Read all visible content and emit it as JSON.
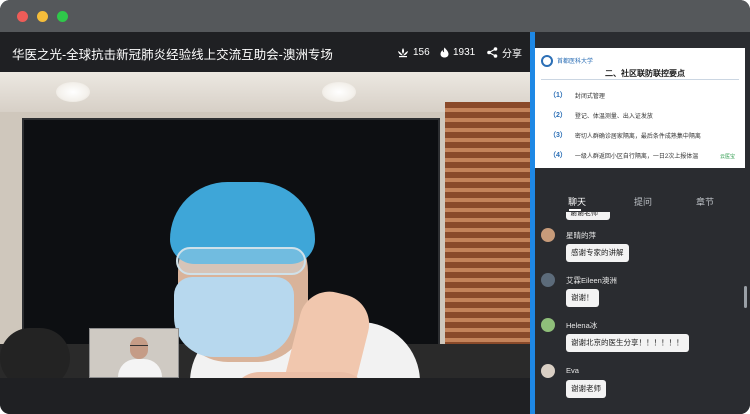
{
  "window": {
    "title_bar_colors": {
      "close": "#ee5c58",
      "minimize": "#f5bd3a",
      "zoom": "#2fc84a"
    }
  },
  "header": {
    "title": "华医之光-全球抗击新冠肺炎经验线上交流互助会-澳洲专场",
    "likes": "156",
    "views": "1931",
    "share_label": "分享"
  },
  "slide": {
    "logo_text": "首都医科大学",
    "title": "二、社区联防联控要点",
    "rows": [
      {
        "num": "（1）",
        "text": "封闭式管理"
      },
      {
        "num": "（2）",
        "text": "登记、体温测量、出入证发放"
      },
      {
        "num": "（3）",
        "text": "密切人群确诊居家隔离，最后条件成熟集中隔离"
      },
      {
        "num": "（4）",
        "text": "一级人群返回小区自行隔离，一日2次上报体温"
      }
    ],
    "brand": "云医宝"
  },
  "tabs": {
    "chat": "聊天",
    "ask": "提问",
    "chapter": "章节"
  },
  "chat": {
    "partial": "谢谢老师",
    "messages": [
      {
        "name": "星晴的萍",
        "text": "感谢专家的讲解",
        "avatar_color": "#c79b7a"
      },
      {
        "name": "艾霖Eileen澳洲",
        "text": "谢谢！",
        "avatar_color": "#5c6b7a"
      },
      {
        "name": "Helena冰",
        "text": "谢谢北京的医生分享！！！！！！",
        "avatar_color": "#8fbf7a"
      },
      {
        "name": "Eva",
        "text": "谢谢老师",
        "avatar_color": "#d9cfc4"
      }
    ]
  },
  "colors": {
    "accent": "#1e88e5",
    "dark_bg": "#1f2023",
    "panel_bg": "#2a2c30"
  }
}
